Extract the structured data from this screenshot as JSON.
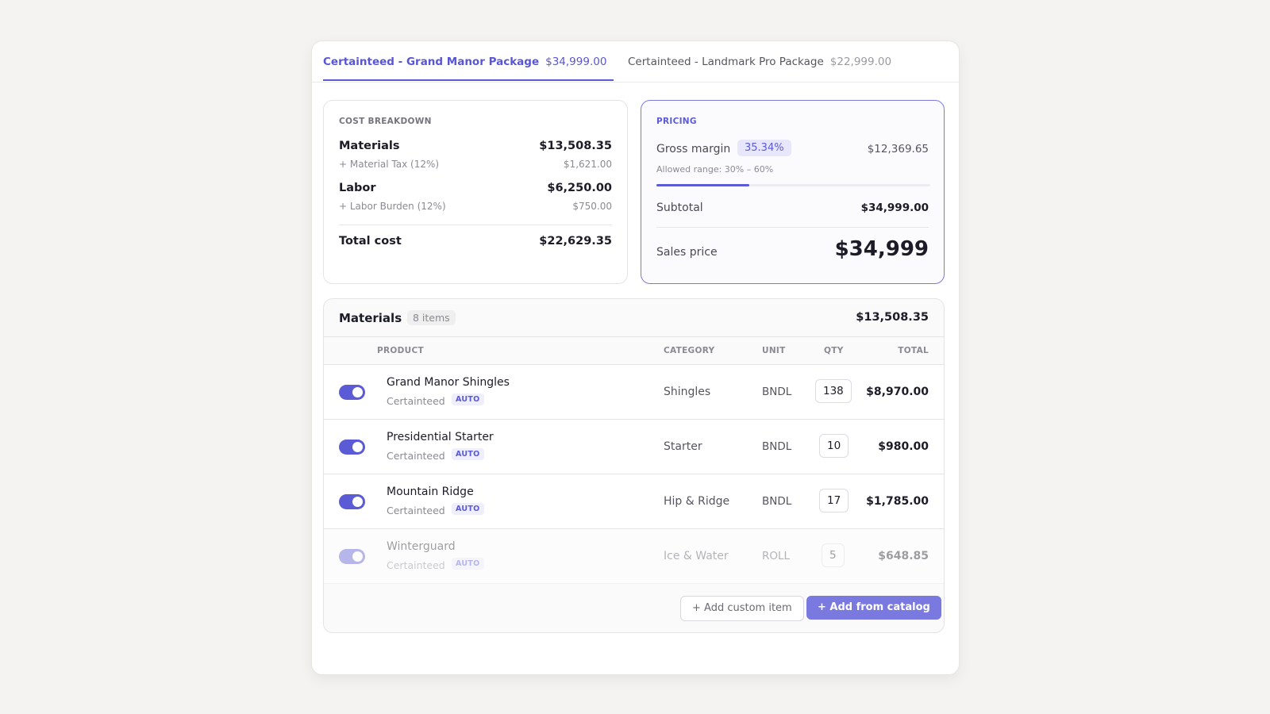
{
  "tabs": [
    {
      "name": "Certainteed - Grand Manor Package",
      "amount": "$34,999.00",
      "active": true
    },
    {
      "name": "Certainteed - Landmark Pro Package",
      "amount": "$22,999.00",
      "active": false
    }
  ],
  "cost_breakdown": {
    "heading": "COST BREAKDOWN",
    "materials_label": "Materials",
    "materials_value": "$13,508.35",
    "material_tax_label": "+ Material Tax (12%)",
    "material_tax_value": "$1,621.00",
    "labor_label": "Labor",
    "labor_value": "$6,250.00",
    "labor_burden_label": "+ Labor Burden (12%)",
    "labor_burden_value": "$750.00",
    "total_label": "Total cost",
    "total_value": "$22,629.35"
  },
  "pricing": {
    "heading": "PRICING",
    "gross_margin_label": "Gross margin",
    "gross_margin_percent": "35.34%",
    "gross_margin_amount": "$12,369.65",
    "allowed_range": "Allowed range: 30% – 60%",
    "margin_bar_fraction": 0.34,
    "subtotal_label": "Subtotal",
    "subtotal_value": "$34,999.00",
    "sales_price_label": "Sales price",
    "sales_price_value": "$34,999"
  },
  "materials": {
    "title": "Materials",
    "count": "8 items",
    "total": "$13,508.35",
    "columns": {
      "product": "PRODUCT",
      "category": "CATEGORY",
      "unit": "UNIT",
      "qty": "QTY",
      "total": "TOTAL"
    },
    "rows": [
      {
        "name": "Grand Manor Shingles",
        "brand": "Certainteed",
        "badge": "AUTO",
        "category": "Shingles",
        "unit": "BNDL",
        "qty": "138",
        "total": "$8,970.00",
        "enabled": true
      },
      {
        "name": "Presidential Starter",
        "brand": "Certainteed",
        "badge": "AUTO",
        "category": "Starter",
        "unit": "BNDL",
        "qty": "10",
        "total": "$980.00",
        "enabled": true
      },
      {
        "name": "Mountain Ridge",
        "brand": "Certainteed",
        "badge": "AUTO",
        "category": "Hip & Ridge",
        "unit": "BNDL",
        "qty": "17",
        "total": "$1,785.00",
        "enabled": true
      },
      {
        "name": "Winterguard",
        "brand": "Certainteed",
        "badge": "AUTO",
        "category": "Ice & Water",
        "unit": "ROLL",
        "qty": "5",
        "total": "$648.85",
        "enabled": false
      }
    ],
    "add_custom_label": "+ Add custom item",
    "add_catalog_label": "+ Add from catalog"
  },
  "colors": {
    "accent": "#5b5bd6",
    "accent_soft": "#e7e6fb",
    "background": "#f4f3f1"
  }
}
